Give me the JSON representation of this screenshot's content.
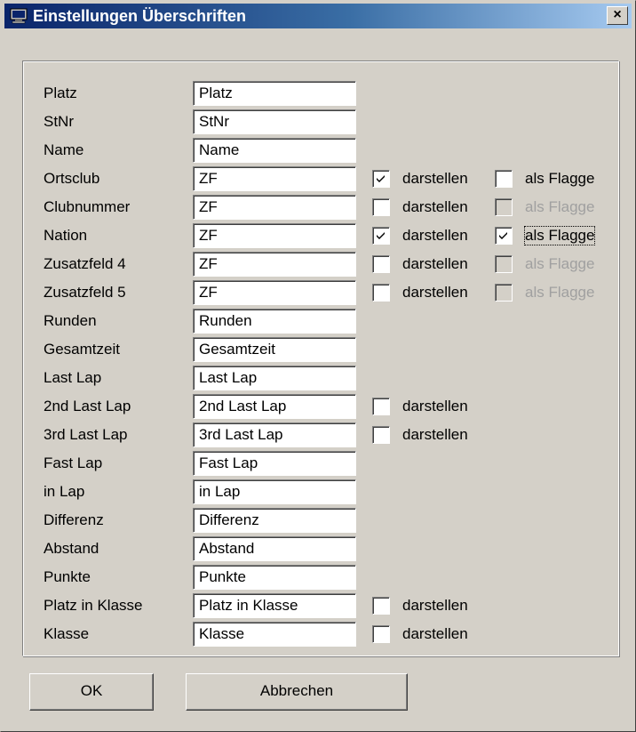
{
  "window": {
    "title": "Einstellungen Überschriften",
    "close_label": "×"
  },
  "check_label": "darstellen",
  "flag_label": "als Flagge",
  "rows": [
    {
      "label": "Platz",
      "value": "Platz"
    },
    {
      "label": "StNr",
      "value": "StNr"
    },
    {
      "label": "Name",
      "value": "Name"
    },
    {
      "label": "Ortsclub",
      "value": "ZF",
      "show": true,
      "flag": false,
      "flag_enabled": true
    },
    {
      "label": "Clubnummer",
      "value": "ZF",
      "show": false,
      "flag": false,
      "flag_enabled": false
    },
    {
      "label": "Nation",
      "value": "ZF",
      "show": true,
      "flag": true,
      "flag_enabled": true,
      "focused": true
    },
    {
      "label": "Zusatzfeld 4",
      "value": "ZF",
      "show": false,
      "flag": false,
      "flag_enabled": false
    },
    {
      "label": "Zusatzfeld 5",
      "value": "ZF",
      "show": false,
      "flag": false,
      "flag_enabled": false
    },
    {
      "label": "Runden",
      "value": "Runden"
    },
    {
      "label": "Gesamtzeit",
      "value": "Gesamtzeit"
    },
    {
      "label": "Last Lap",
      "value": "Last Lap"
    },
    {
      "label": "2nd Last Lap",
      "value": "2nd Last Lap",
      "show": false
    },
    {
      "label": "3rd Last Lap",
      "value": "3rd Last Lap",
      "show": false
    },
    {
      "label": "Fast Lap",
      "value": "Fast Lap"
    },
    {
      "label": "in Lap",
      "value": "in Lap"
    },
    {
      "label": "Differenz",
      "value": "Differenz"
    },
    {
      "label": "Abstand",
      "value": "Abstand"
    },
    {
      "label": "Punkte",
      "value": "Punkte"
    },
    {
      "label": "Platz in Klasse",
      "value": "Platz in Klasse",
      "show": false
    },
    {
      "label": "Klasse",
      "value": "Klasse",
      "show": false
    }
  ],
  "buttons": {
    "ok": "OK",
    "cancel": "Abbrechen"
  }
}
